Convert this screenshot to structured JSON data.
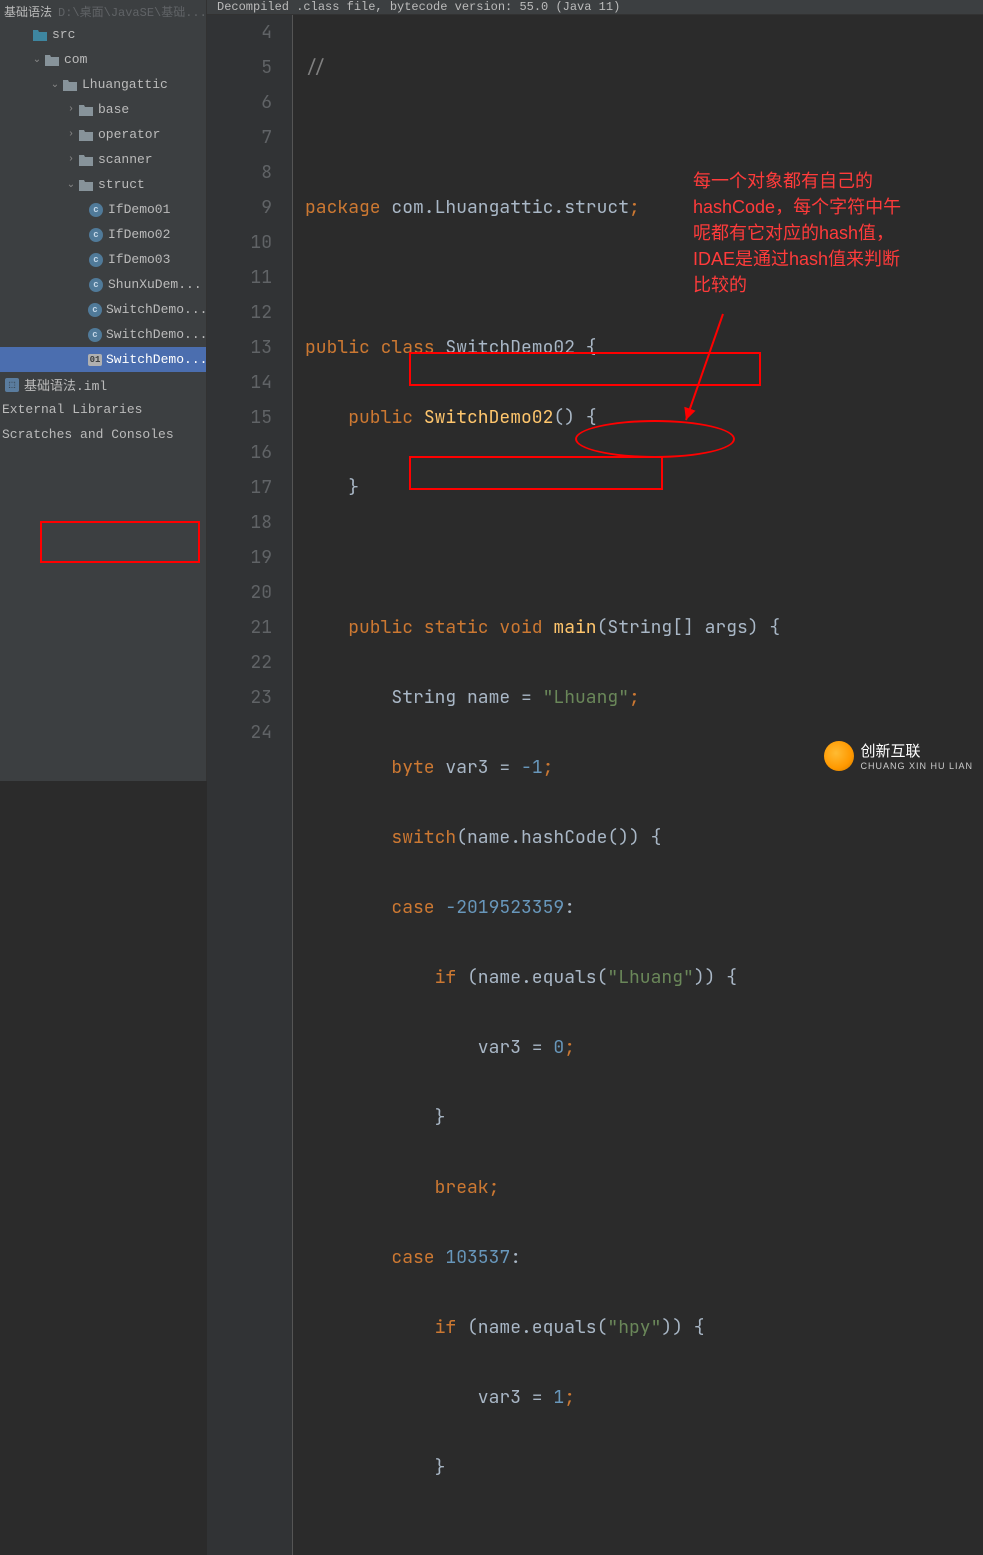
{
  "breadcrumb": {
    "project": "基础语法",
    "path": "D:\\桌面\\JavaSE\\基础..."
  },
  "tree": {
    "src": "src",
    "com": "com",
    "pkg": "Lhuangattic",
    "base": "base",
    "operator": "operator",
    "scanner": "scanner",
    "struct": "struct",
    "files": {
      "if1": "IfDemo01",
      "if2": "IfDemo02",
      "if3": "IfDemo03",
      "shun": "ShunXuDem...",
      "sw1": "SwitchDemo...",
      "sw2": "SwitchDemo...",
      "sw3": "SwitchDemo..."
    },
    "iml": "基础语法.iml",
    "extlib": "External Libraries",
    "scratch": "Scratches and Consoles"
  },
  "notice": "Decompiled .class file, bytecode version: 55.0 (Java 11)",
  "gutter": [
    "4",
    "5",
    "6",
    "7",
    "8",
    "9",
    "10",
    "11",
    "12",
    "13",
    "14",
    "15",
    "16",
    "17",
    "18",
    "19",
    "20",
    "21",
    "22",
    "23",
    "24"
  ],
  "code": {
    "l4": "//",
    "l6_a": "package",
    "l6_b": " com.Lhuangattic.struct",
    "l6_c": ";",
    "l8_a": "public class ",
    "l8_b": "SwitchDemo02 {",
    "l9_a": "    public ",
    "l9_b": "SwitchDemo02",
    "l9_c": "() {",
    "l10": "    }",
    "l12_a": "    public static void ",
    "l12_b": "main",
    "l12_c": "(String[] args) {",
    "l13_a": "        String name = ",
    "l13_b": "\"Lhuang\"",
    "l13_c": ";",
    "l14_a": "        byte ",
    "l14_b": "var3 = ",
    "l14_c": "-1",
    "l14_d": ";",
    "l15_a": "        switch",
    "l15_b": "(name.hashCode()) {",
    "l16_a": "        case ",
    "l16_b": "-2019523359",
    "l16_c": ":",
    "l17_a": "            if ",
    "l17_b": "(name.equals(",
    "l17_c": "\"Lhuang\"",
    "l17_d": ")) {",
    "l18_a": "                var3 = ",
    "l18_b": "0",
    "l18_c": ";",
    "l19": "            }",
    "l20_a": "            break",
    "l20_b": ";",
    "l21_a": "        case ",
    "l21_b": "103537",
    "l21_c": ":",
    "l22_a": "            if ",
    "l22_b": "(name.equals(",
    "l22_c": "\"hpy\"",
    "l22_d": ")) {",
    "l23_a": "                var3 = ",
    "l23_b": "1",
    "l23_c": ";",
    "l24": "            }"
  },
  "annotation": {
    "text": "每一个对象都有自己的\nhashCode，每个字符中午\n呢都有它对应的hash值，\nIDAE是通过hash值来判断\n比较的"
  },
  "watermark": {
    "main": "创新互联",
    "sub": "CHUANG XIN HU LIAN"
  }
}
